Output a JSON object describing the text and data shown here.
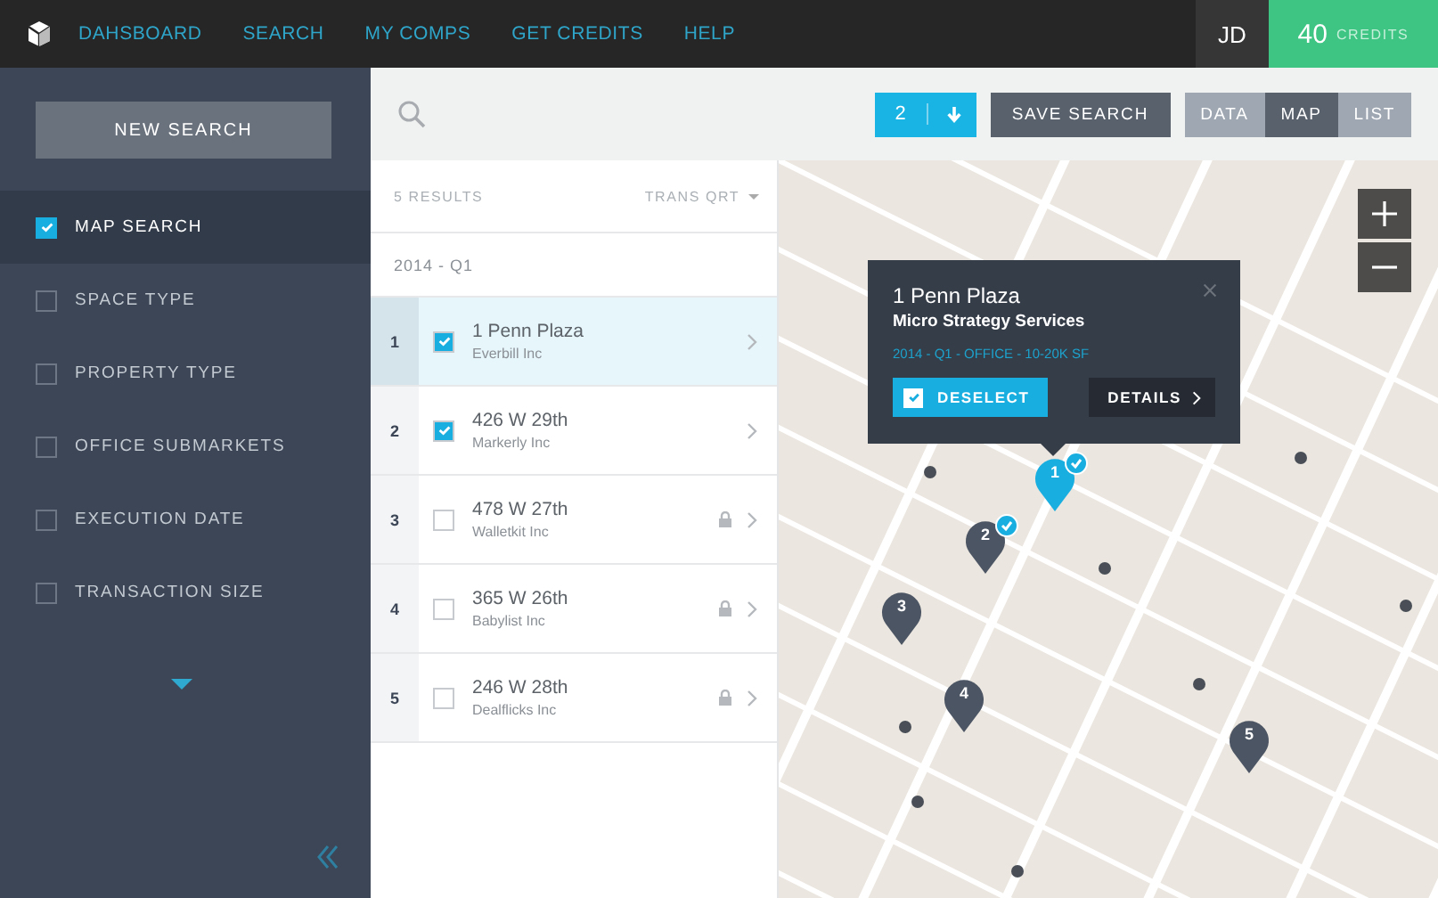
{
  "nav": {
    "links": [
      "DAHSBOARD",
      "SEARCH",
      "MY COMPS",
      "GET CREDITS",
      "HELP"
    ],
    "user_initials": "JD",
    "credits": {
      "count": "40",
      "label": "CREDITS"
    }
  },
  "sidebar": {
    "new_search": "NEW SEARCH",
    "filters": [
      {
        "label": "MAP SEARCH",
        "checked": true
      },
      {
        "label": "SPACE TYPE",
        "checked": false
      },
      {
        "label": "PROPERTY TYPE",
        "checked": false
      },
      {
        "label": "OFFICE SUBMARKETS",
        "checked": false
      },
      {
        "label": "EXECUTION DATE",
        "checked": false
      },
      {
        "label": "TRANSACTION SIZE",
        "checked": false
      }
    ]
  },
  "toolbar": {
    "selected_count": "2",
    "save_search": "SAVE SEARCH",
    "views": [
      {
        "label": "DATA",
        "selected": false
      },
      {
        "label": "MAP",
        "selected": true
      },
      {
        "label": "LIST",
        "selected": false
      }
    ]
  },
  "results": {
    "count_label": "5 RESULTS",
    "sort": "TRANS QRT",
    "group": "2014 - Q1",
    "rows": [
      {
        "index": "1",
        "address": "1 Penn Plaza",
        "company": "Everbill Inc",
        "checked": true,
        "selected": true,
        "locked": false
      },
      {
        "index": "2",
        "address": "426 W 29th",
        "company": "Markerly Inc",
        "checked": true,
        "selected": false,
        "locked": false
      },
      {
        "index": "3",
        "address": "478 W 27th",
        "company": "Walletkit Inc",
        "checked": false,
        "selected": false,
        "locked": true
      },
      {
        "index": "4",
        "address": "365 W 26th",
        "company": "Babylist Inc",
        "checked": false,
        "selected": false,
        "locked": true
      },
      {
        "index": "5",
        "address": "246 W 28th",
        "company": "Dealflicks Inc",
        "checked": false,
        "selected": false,
        "locked": true
      }
    ]
  },
  "map": {
    "popup": {
      "title": "1 Penn Plaza",
      "company": "Micro Strategy Services",
      "meta": "2014 - Q1 - OFFICE - 10-20K SF",
      "deselect": "DESELECT",
      "details": "DETAILS"
    },
    "pins": [
      {
        "label": "1",
        "selected": true,
        "checked": true
      },
      {
        "label": "2",
        "selected": false,
        "checked": true
      },
      {
        "label": "3",
        "selected": false,
        "checked": false
      },
      {
        "label": "4",
        "selected": false,
        "checked": false
      },
      {
        "label": "5",
        "selected": false,
        "checked": false
      }
    ]
  }
}
